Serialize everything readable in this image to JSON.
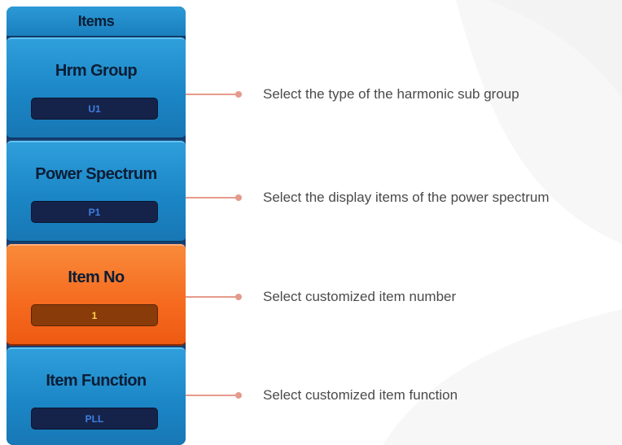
{
  "panel": {
    "title": "Items",
    "items": [
      {
        "label": "Hrm Group",
        "value": "U1",
        "active": false
      },
      {
        "label": "Power Spectrum",
        "value": "P1",
        "active": false
      },
      {
        "label": "Item No",
        "value": "1",
        "active": true
      },
      {
        "label": "Item Function",
        "value": "PLL",
        "active": false
      }
    ]
  },
  "callouts": [
    {
      "text": "Select the type of the harmonic sub group"
    },
    {
      "text": "Select the display items of the power spectrum"
    },
    {
      "text": "Select customized item number"
    },
    {
      "text": "Select customized item function"
    }
  ],
  "colors": {
    "panel_blue": "#1b86c6",
    "active_orange": "#f56a1e",
    "callout_line": "#e59a8c",
    "text_gray": "#4a4a4a"
  }
}
